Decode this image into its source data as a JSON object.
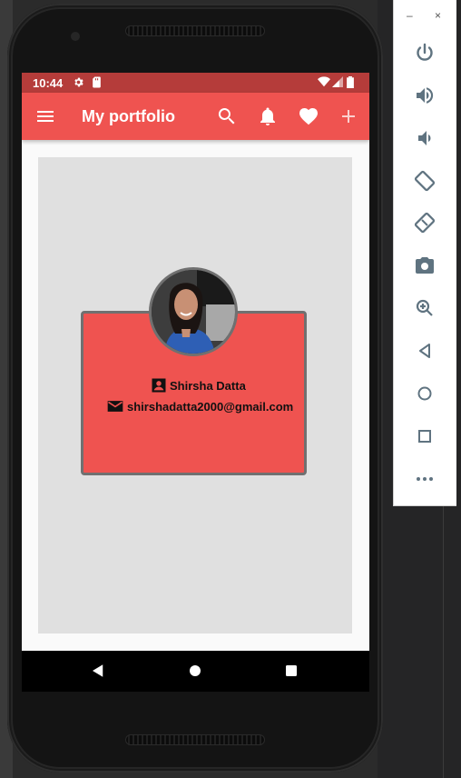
{
  "device": {
    "status_bar": {
      "time": "10:44"
    },
    "app_bar": {
      "title": "My portfolio",
      "icons": [
        "menu-icon",
        "search-icon",
        "bell-icon",
        "heart-icon",
        "add-icon"
      ]
    },
    "profile_card": {
      "name": "Shirsha Datta",
      "email": "shirshadatta2000@gmail.com"
    },
    "nav_bar": {
      "icons": [
        "back-icon",
        "home-icon",
        "recents-icon"
      ]
    }
  },
  "emulator_panel": {
    "window_controls": [
      "–",
      "×"
    ],
    "buttons": [
      "power-icon",
      "volume-up-icon",
      "volume-down-icon",
      "rotate-left-icon",
      "rotate-right-icon",
      "camera-icon",
      "zoom-icon",
      "back-icon",
      "home-icon",
      "overview-icon",
      "more-icon"
    ]
  },
  "colors": {
    "app_bar": "#ef5350",
    "status_bar": "#b53c3a",
    "card": "#ef5350",
    "card_border": "#707070",
    "body_background": "#e0e0e0"
  }
}
